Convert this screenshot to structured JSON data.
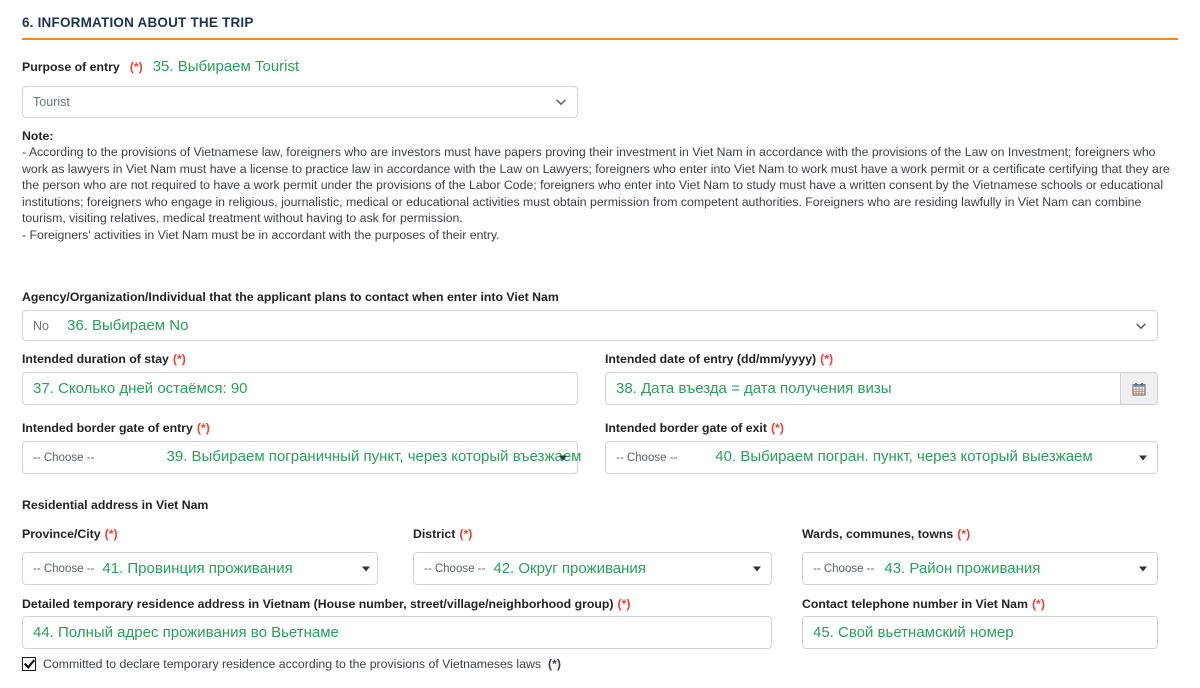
{
  "section": {
    "title": "6. INFORMATION ABOUT THE TRIP",
    "accent_color": "#ef8b22",
    "title_color": "#1f3350",
    "annotation_color": "#2e9e5b"
  },
  "purpose_of_entry": {
    "label": "Purpose of entry",
    "required_mark": "(*)",
    "annotation": "35. Выбираем Tourist",
    "value": "Tourist",
    "icon": "chevron-down-icon"
  },
  "note": {
    "heading": "Note:",
    "paragraphs": [
      "- According to the provisions of Vietnamese law, foreigners who are investors must have papers proving their investment in Viet Nam in accordance with the provisions of the Law on Investment; foreigners who work as lawyers in Viet Nam must have a license to practice law in accordance with the Law on Lawyers; foreigners who enter into Viet Nam to work must have a work permit or a certificate certifying that they are the person who are not required to have a work permit under the provisions of the Labor Code; foreigners who enter into Viet Nam to study must have a written consent by the Vietnamese schools or educational institutions; foreigners who engage in religious, journalistic, medical or educational activities must obtain permission from competent authorities. Foreigners who are residing lawfully in Viet Nam can combine tourism, visiting relatives, medical treatment without having to ask for permission.",
      "- Foreigners' activities in Viet Nam must be in accordant with the purposes of their entry."
    ]
  },
  "agency": {
    "label": "Agency/Organization/Individual that the applicant plans to contact when enter into Viet Nam",
    "value": "No",
    "annotation": "36. Выбираем No",
    "icon": "chevron-down-icon"
  },
  "duration_of_stay": {
    "label": "Intended duration of stay",
    "required_mark": "(*)",
    "annotation": "37. Сколько дней остаёмся: 90"
  },
  "date_of_entry": {
    "label": "Intended date of entry (dd/mm/yyyy)",
    "required_mark": "(*)",
    "annotation": "38. Дата въезда = дата получения визы",
    "icon": "calendar-icon"
  },
  "border_gate_entry": {
    "label": "Intended border gate of entry",
    "required_mark": "(*)",
    "placeholder": "-- Choose --",
    "annotation": "39. Выбираем пограничный пункт, через который въезжаем",
    "icon": "caret-down-icon"
  },
  "border_gate_exit": {
    "label": "Intended border gate of exit",
    "required_mark": "(*)",
    "placeholder": "-- Choose --",
    "annotation": "40. Выбираем погран. пункт, через который выезжаем",
    "icon": "caret-down-icon"
  },
  "residential_address_heading": "Residential address in Viet Nam",
  "province": {
    "label": "Province/City",
    "required_mark": "(*)",
    "placeholder": "-- Choose --",
    "annotation": "41. Провинция проживания",
    "icon": "caret-down-icon"
  },
  "district": {
    "label": "District",
    "required_mark": "(*)",
    "placeholder": "-- Choose --",
    "annotation": "42. Округ проживания",
    "icon": "caret-down-icon"
  },
  "wards": {
    "label": "Wards, communes, towns",
    "required_mark": "(*)",
    "placeholder": "-- Choose --",
    "annotation": "43. Район проживания",
    "icon": "caret-down-icon"
  },
  "detailed_address": {
    "label": "Detailed temporary residence address in Vietnam (House number, street/village/neighborhood group)",
    "required_mark": "(*)",
    "annotation": "44. Полный адрес проживания во Вьетнаме"
  },
  "contact_phone": {
    "label": "Contact telephone number in Viet Nam",
    "required_mark": "(*)",
    "annotation": "45. Свой вьетнамский номер"
  },
  "commitment": {
    "label": "Committed to declare temporary residence according to the provisions of Vietnameses laws",
    "required_mark": "(*)",
    "checked": true,
    "icon": "checkbox-checked-icon"
  }
}
